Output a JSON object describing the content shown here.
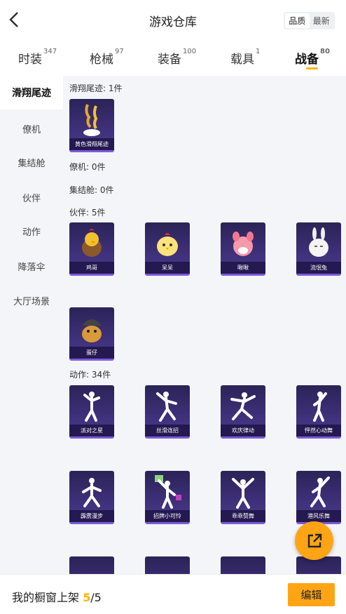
{
  "header": {
    "title": "游戏仓库",
    "sort_quality": "品质",
    "sort_newest": "最新"
  },
  "tabs": [
    {
      "label": "时装",
      "count": "347"
    },
    {
      "label": "枪械",
      "count": "97"
    },
    {
      "label": "装备",
      "count": "100"
    },
    {
      "label": "载具",
      "count": "1"
    },
    {
      "label": "战备",
      "count": "80"
    }
  ],
  "sidebar": {
    "items": [
      {
        "label": "滑翔尾迹"
      },
      {
        "label": "僚机"
      },
      {
        "label": "集结舱"
      },
      {
        "label": "伙伴"
      },
      {
        "label": "动作"
      },
      {
        "label": "降落伞"
      },
      {
        "label": "大厅场景"
      }
    ]
  },
  "sections": {
    "glide": {
      "title": "滑翔尾迹: 1件",
      "items": [
        "黄色滑翔尾迹"
      ]
    },
    "wingman": {
      "title": "僚机: 0件"
    },
    "pod": {
      "title": "集结舱: 0件"
    },
    "partner": {
      "title": "伙伴: 5件",
      "items": [
        "鸡哥",
        "呆呆",
        "啾啾",
        "流氓兔",
        "蛋仔"
      ]
    },
    "emote": {
      "title": "动作: 34件",
      "items": [
        "派对之星",
        "丝滑连招",
        "欢庆律动",
        "怦然心动舞",
        "霹雳漫步",
        "招牌小可怜",
        "乖乖赞舞",
        "港风乐舞"
      ]
    }
  },
  "bottom": {
    "shelf_label": "我的橱窗上架",
    "shelf_current": "5",
    "shelf_total": "/5",
    "edit_label": "编辑"
  },
  "colors": {
    "accent": "#ffb400",
    "card_bg": "#3d2f77",
    "card_border": "#7d5bd8"
  },
  "icons": {
    "back": "chevron-left-icon",
    "share": "share-external-icon"
  }
}
